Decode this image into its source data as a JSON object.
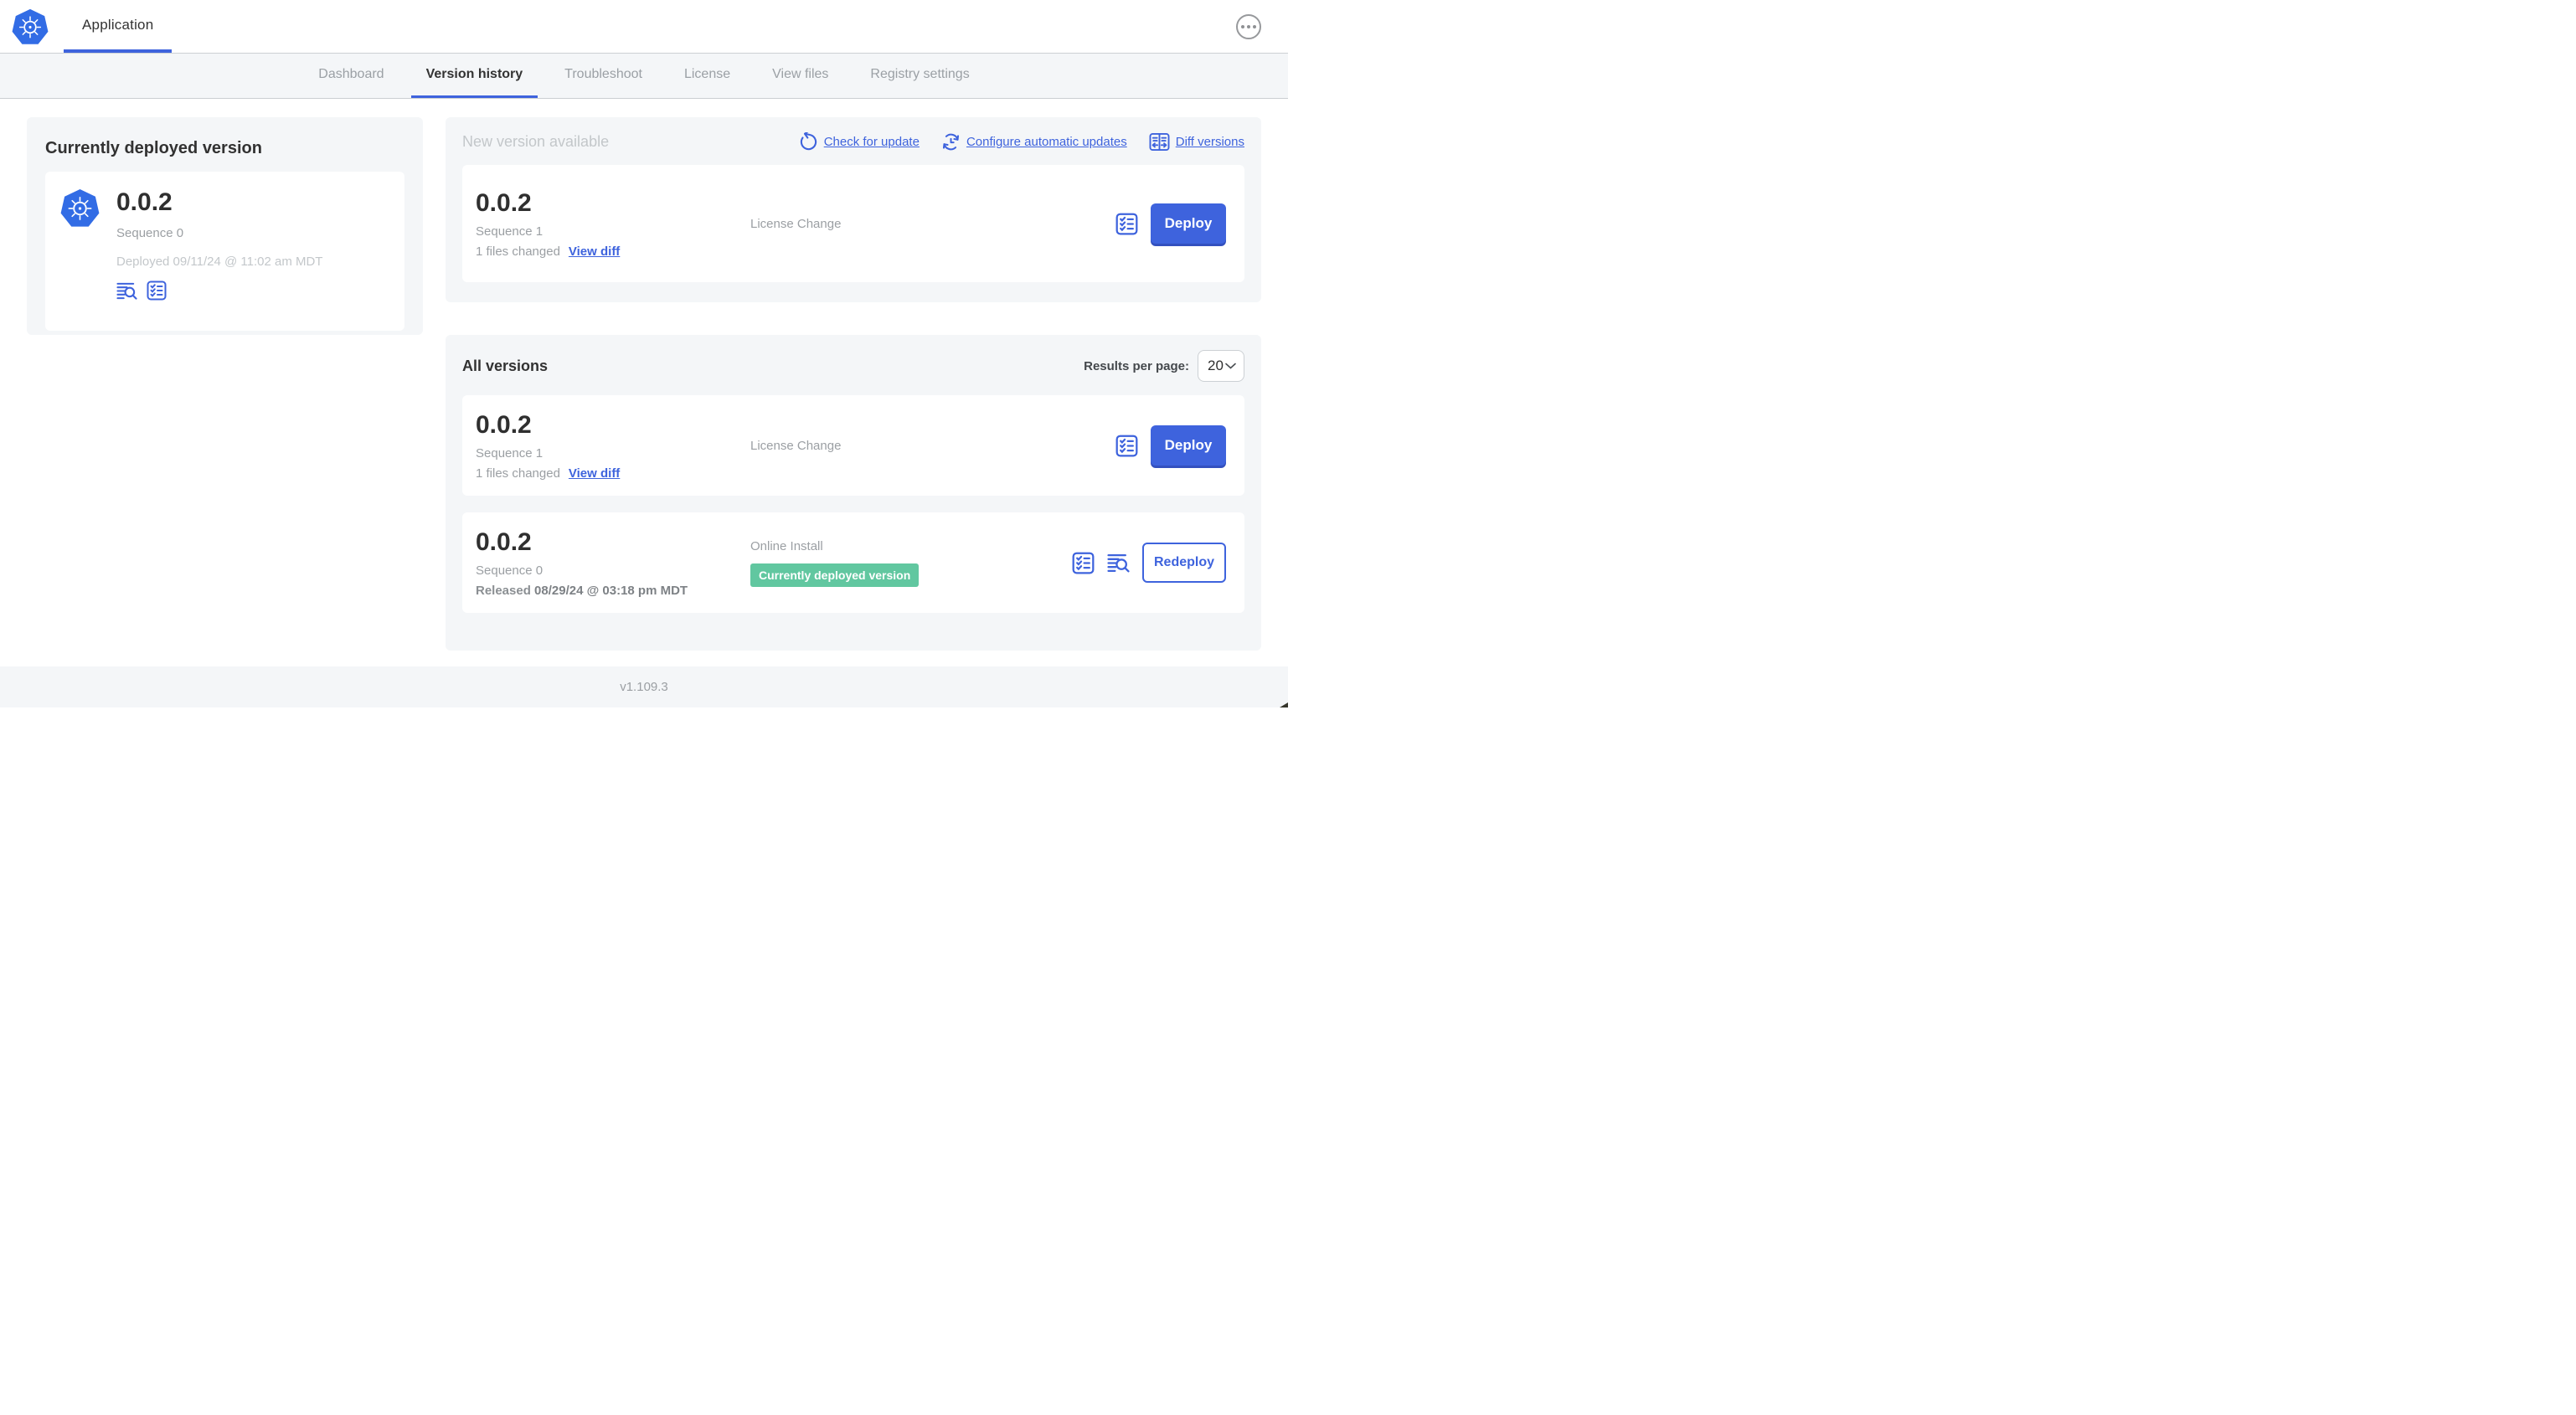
{
  "header": {
    "app_tab_label": "Application",
    "logo_icon": "kubernetes-logo",
    "menu_icon": "ellipsis-icon"
  },
  "nav": {
    "tabs": [
      {
        "label": "Dashboard",
        "active": false
      },
      {
        "label": "Version history",
        "active": true
      },
      {
        "label": "Troubleshoot",
        "active": false
      },
      {
        "label": "License",
        "active": false
      },
      {
        "label": "View files",
        "active": false
      },
      {
        "label": "Registry settings",
        "active": false
      }
    ]
  },
  "current_version": {
    "title": "Currently deployed version",
    "version": "0.0.2",
    "sequence": "Sequence 0",
    "deployed": "Deployed 09/11/24 @ 11:02 am MDT",
    "icons": [
      "logs-icon",
      "preflight-checks-icon"
    ]
  },
  "new_version": {
    "title": "New version available",
    "actions": [
      {
        "label": "Check for update",
        "icon": "refresh-icon"
      },
      {
        "label": "Configure automatic updates",
        "icon": "auto-update-schedule-icon"
      },
      {
        "label": "Diff versions",
        "icon": "diff-icon"
      }
    ],
    "row": {
      "version": "0.0.2",
      "sequence": "Sequence 1",
      "files_changed": "1 files changed",
      "view_diff_label": "View diff",
      "source": "License Change",
      "deploy_label": "Deploy"
    }
  },
  "all_versions": {
    "title": "All versions",
    "results_per_page_label": "Results per page:",
    "results_per_page_value": "20",
    "rows": [
      {
        "version": "0.0.2",
        "sequence": "Sequence 1",
        "files_changed": "1 files changed",
        "view_diff_label": "View diff",
        "source": "License Change",
        "action_label": "Deploy"
      },
      {
        "version": "0.0.2",
        "sequence": "Sequence 0",
        "released_prefix": "Released",
        "released_date": "08/29/24 @ 03:18 pm MDT",
        "source": "Online Install",
        "badge": "Currently deployed version",
        "action_label": "Redeploy"
      }
    ]
  },
  "footer": {
    "version": "v1.109.3"
  },
  "colors": {
    "accent_blue": "#3e63dd",
    "logo_blue": "#326ce5",
    "badge_green": "#61c7a0",
    "panel_gray": "#f4f6f8",
    "text_dark": "#323232",
    "text_gray": "#9b9fa3",
    "text_light_gray": "#c3c7ca"
  }
}
